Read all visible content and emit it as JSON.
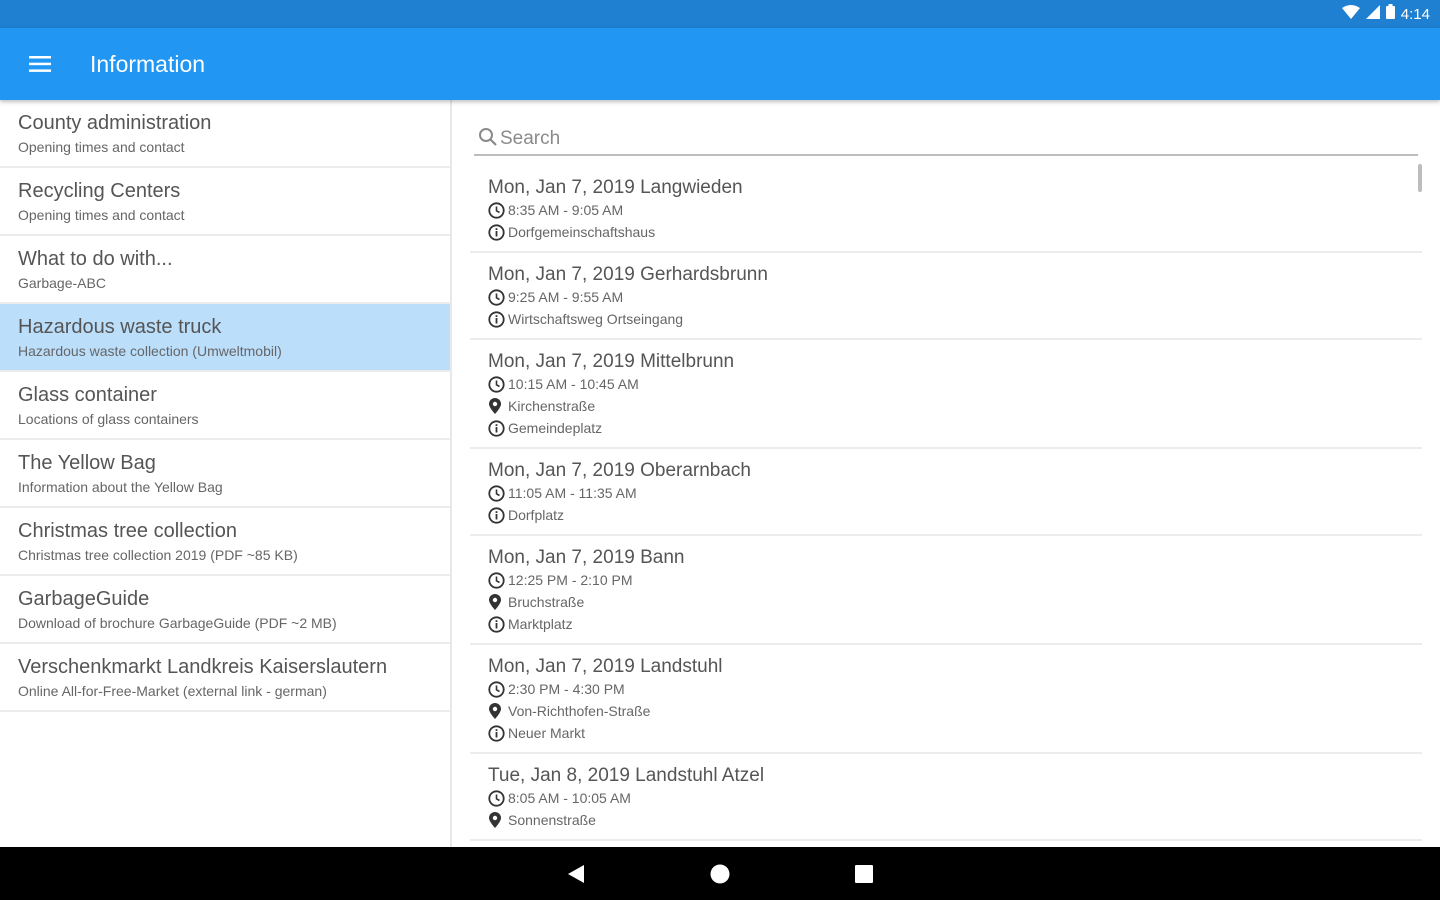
{
  "status_bar": {
    "time": "4:14"
  },
  "app_bar": {
    "title": "Information"
  },
  "sidebar": {
    "items": [
      {
        "title": "County administration",
        "subtitle": "Opening times and contact",
        "active": false
      },
      {
        "title": "Recycling Centers",
        "subtitle": "Opening times and contact",
        "active": false
      },
      {
        "title": "What to do with...",
        "subtitle": "Garbage-ABC",
        "active": false
      },
      {
        "title": "Hazardous waste truck",
        "subtitle": "Hazardous waste collection (Umweltmobil)",
        "active": true
      },
      {
        "title": "Glass container",
        "subtitle": "Locations of glass containers",
        "active": false
      },
      {
        "title": "The Yellow Bag",
        "subtitle": "Information about the Yellow Bag",
        "active": false
      },
      {
        "title": "Christmas tree collection",
        "subtitle": "Christmas tree collection 2019 (PDF ~85 KB)",
        "active": false
      },
      {
        "title": "GarbageGuide",
        "subtitle": "Download of brochure GarbageGuide (PDF ~2 MB)",
        "active": false
      },
      {
        "title": "Verschenkmarkt Landkreis Kaiserslautern",
        "subtitle": "Online All-for-Free-Market (external link - german)",
        "active": false
      }
    ]
  },
  "search": {
    "placeholder": "Search"
  },
  "events": [
    {
      "title": "Mon, Jan 7, 2019 Langwieden",
      "time": "8:35 AM - 9:05 AM",
      "street": "",
      "info": "Dorfgemeinschaftshaus"
    },
    {
      "title": "Mon, Jan 7, 2019 Gerhardsbrunn",
      "time": "9:25 AM - 9:55 AM",
      "street": "",
      "info": "Wirtschaftsweg Ortseingang"
    },
    {
      "title": "Mon, Jan 7, 2019 Mittelbrunn",
      "time": "10:15 AM - 10:45 AM",
      "street": "Kirchenstraße",
      "info": "Gemeindeplatz"
    },
    {
      "title": "Mon, Jan 7, 2019 Oberarnbach",
      "time": "11:05 AM - 11:35 AM",
      "street": "",
      "info": "Dorfplatz"
    },
    {
      "title": "Mon, Jan 7, 2019 Bann",
      "time": "12:25 PM - 2:10 PM",
      "street": "Bruchstraße",
      "info": "Marktplatz"
    },
    {
      "title": "Mon, Jan 7, 2019 Landstuhl",
      "time": "2:30 PM - 4:30 PM",
      "street": "Von-Richthofen-Straße",
      "info": "Neuer Markt"
    },
    {
      "title": "Tue, Jan 8, 2019 Landstuhl Atzel",
      "time": "8:05 AM - 10:05 AM",
      "street": "Sonnenstraße",
      "info": ""
    }
  ],
  "colors": {
    "status_bar": "#1f7fd0",
    "app_bar": "#2196f3",
    "active_item": "#bbdefb",
    "nav_bar": "#000000"
  }
}
